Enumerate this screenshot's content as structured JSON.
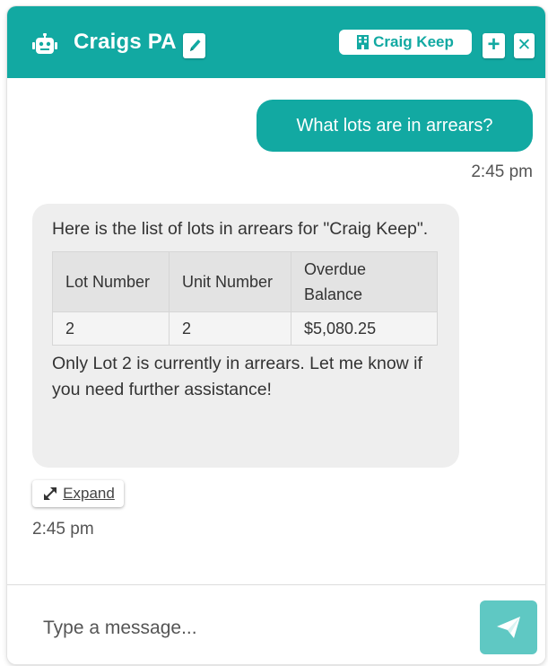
{
  "header": {
    "title": "Craigs PA",
    "building_name": "Craig Keep",
    "icons": {
      "bot": "robot-icon",
      "edit": "pencil-icon",
      "building": "building-icon",
      "add": "plus-icon",
      "close": "close-icon"
    }
  },
  "conversation": {
    "user_message": {
      "text": "What lots are in arrears?",
      "time": "2:45 pm"
    },
    "bot_message": {
      "intro": "Here is the list of lots in arrears for \"Craig Keep\".",
      "table": {
        "headers": [
          "Lot Number",
          "Unit Number",
          "Overdue Balance"
        ],
        "rows": [
          [
            "2",
            "2",
            "$5,080.25"
          ]
        ]
      },
      "outro": "Only Lot 2 is currently in arrears. Let me know if you need further assistance!",
      "expand_label": "Expand",
      "time": "2:45 pm"
    }
  },
  "composer": {
    "placeholder": "Type a message..."
  },
  "colors": {
    "accent": "#12a9a2",
    "send_button": "#5fc8c3",
    "bot_bubble": "#eeeeee"
  }
}
